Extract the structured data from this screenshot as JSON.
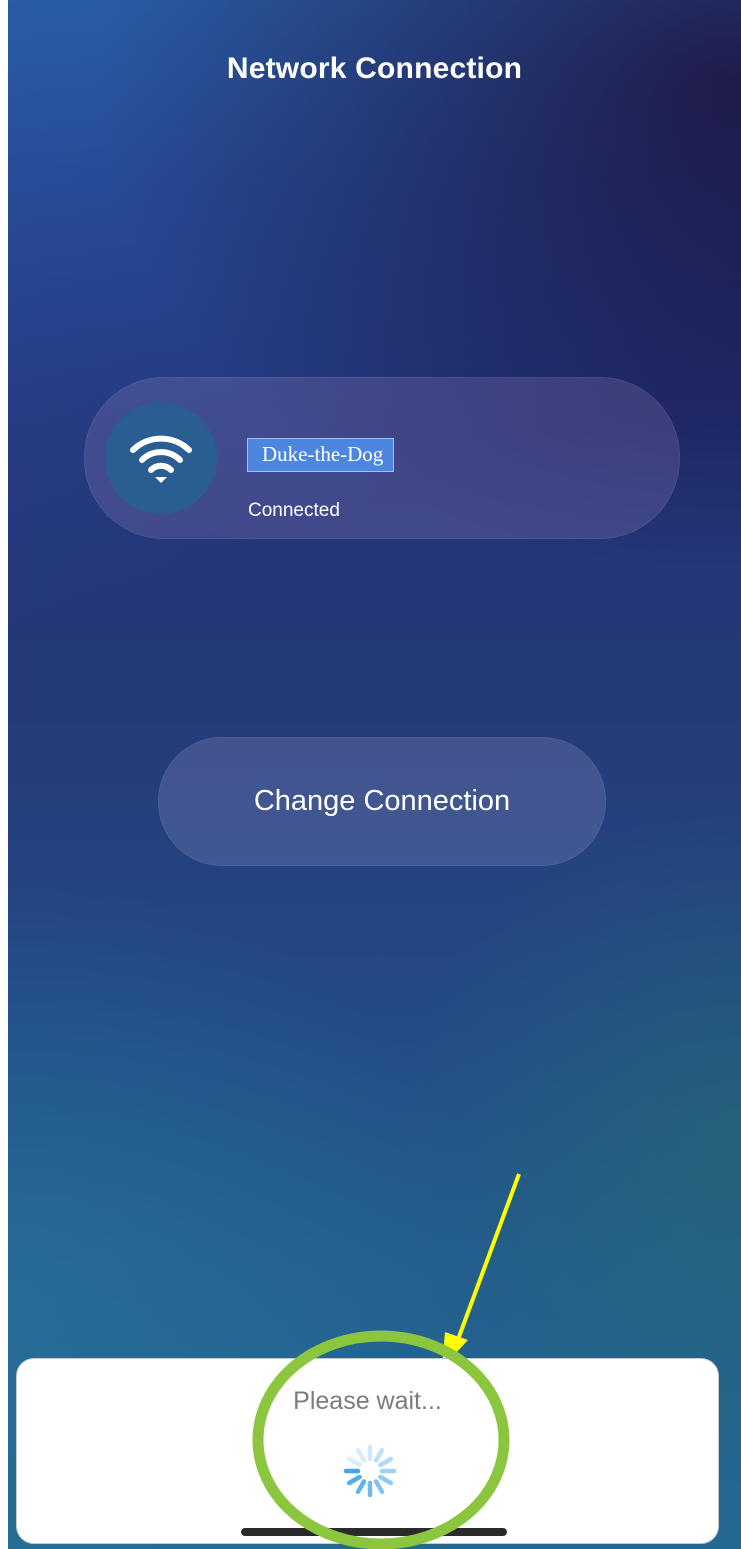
{
  "header": {
    "title": "Network Connection"
  },
  "network": {
    "name": "Duke-the-Dog",
    "status": "Connected",
    "icon": "wifi-icon"
  },
  "actions": {
    "change_connection_label": "Change Connection"
  },
  "loading": {
    "message": "Please wait...",
    "icon": "spinner-icon"
  },
  "annotations": {
    "arrow_color": "#ffff00",
    "ring_color": "#8cc63f"
  },
  "colors": {
    "selection_highlight": "#4d86df",
    "wifi_circle": "#2a5d92",
    "spinner": "#3aa0e8"
  }
}
